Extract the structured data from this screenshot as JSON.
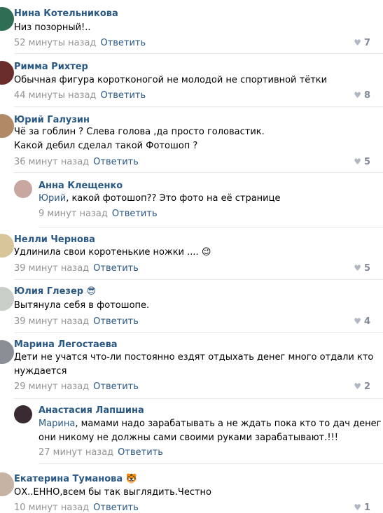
{
  "comments": [
    {
      "author": "Нина Котельникова",
      "text": "Низ позорный!..",
      "time": "52 минуты назад",
      "reply": "Ответить",
      "likes": "7",
      "avatar_color": "#2f6e52"
    },
    {
      "author": "Римма Рихтер",
      "text": "Обычная фигура коротконогой не молодой не спортивной тётки",
      "time": "44 минуты назад",
      "reply": "Ответить",
      "likes": "8",
      "avatar_color": "#6b2c2c"
    },
    {
      "author": "Юрий Галузин",
      "text1": "Чё за гоблин ? Слева голова ,да просто головастик.",
      "text2": "Какой дебил сделал такой Фотошоп ?",
      "time": "36 минут назад",
      "reply": "Ответить",
      "likes": "5",
      "avatar_color": "#b08a67"
    },
    {
      "author": "Анна Клещенко",
      "mention": "Юрий",
      "text": ", какой фотошоп?? Это фото на её странице",
      "time": "9 минут назад",
      "reply": "Ответить",
      "avatar_color": "#c9a7a1"
    },
    {
      "author": "Нелли Чернова",
      "text": "Удлинила свои коротенькие ножки ....",
      "emoji": "😉",
      "time": "39 минут назад",
      "reply": "Ответить",
      "likes": "5",
      "avatar_color": "#d9c59a"
    },
    {
      "author": "Юлия Глезер",
      "author_emoji": "😎",
      "text": "Вытянула себя в фотошопе.",
      "time": "39 минут назад",
      "reply": "Ответить",
      "likes": "4",
      "avatar_color": "#c9cec8"
    },
    {
      "author": "Марина Легостаева",
      "text1": "Дети не учатся что-ли постоянно ездят отдыхать денег много отдали кто",
      "text2": "нуждается",
      "time": "29 минут назад",
      "reply": "Ответить",
      "likes": "2",
      "avatar_color": "#8a8f96"
    },
    {
      "author": "Анастасия Лапшина",
      "mention": "Марина",
      "text1": ", мамами надо зарабатывать а не ждать пока кто то дач денег",
      "text2": "они никому не должны сами своими руками зарабатывают.!!!",
      "time": "27 минут назад",
      "reply": "Ответить",
      "avatar_color": "#3a2a33"
    },
    {
      "author": "Екатерина Туманова",
      "author_emoji": "🐯",
      "text": "ОХ..ЕННО,всем бы так выглядить.Честно",
      "time": "10 минут назад",
      "reply": "Ответить",
      "likes": "1",
      "avatar_color": "#c7b3a4"
    }
  ],
  "icons": {
    "like": "heart-icon"
  }
}
